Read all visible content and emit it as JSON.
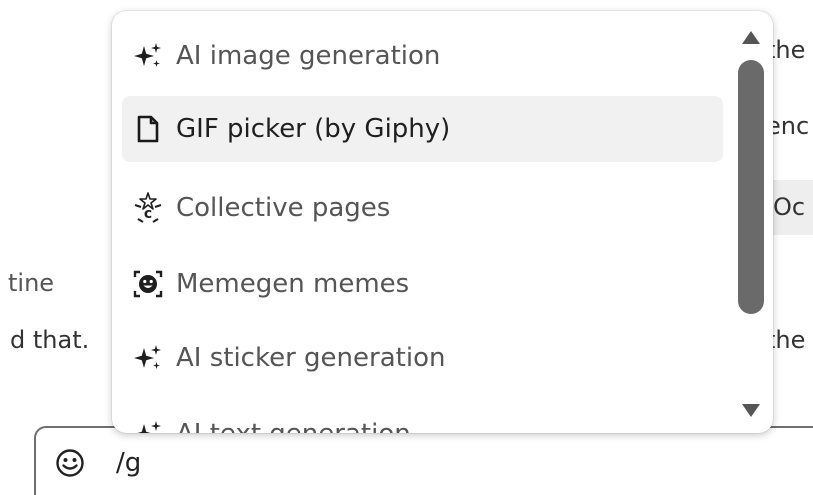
{
  "background": {
    "fragments": {
      "right_1": "the",
      "right_2": "enc",
      "right_chip": "Oc",
      "left_1": "tine",
      "left_2": "d that.",
      "right_3": "the"
    }
  },
  "menu": {
    "items": [
      {
        "label": "AI image generation",
        "icon": "sparkles-icon",
        "active": false
      },
      {
        "label": "GIF picker (by Giphy)",
        "icon": "document-icon",
        "active": true
      },
      {
        "label": "Collective pages",
        "icon": "collective-icon",
        "active": false
      },
      {
        "label": "Memegen memes",
        "icon": "meme-face-icon",
        "active": false
      },
      {
        "label": "AI sticker generation",
        "icon": "sparkles-icon",
        "active": false
      },
      {
        "label": "AI text generation",
        "icon": "sparkles-icon",
        "active": false
      }
    ]
  },
  "composer": {
    "value": "/g",
    "emoji_icon": "smiley-icon"
  },
  "colors": {
    "highlight": "#f1f1f1",
    "scroll_thumb": "#6a6a6a",
    "composer_border": "#6f6f6f"
  }
}
